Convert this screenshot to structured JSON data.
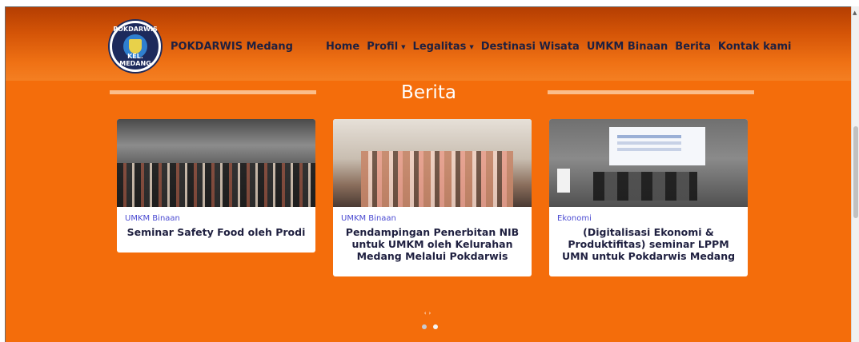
{
  "header": {
    "brand": "POKDARWIS Medang",
    "logo_text_top": "POKDARWIS",
    "logo_text_bottom": "KEL. MEDANG",
    "nav": [
      {
        "label": "Home",
        "dropdown": false
      },
      {
        "label": "Profil",
        "dropdown": true
      },
      {
        "label": "Legalitas",
        "dropdown": true
      },
      {
        "label": "Destinasi Wisata",
        "dropdown": false
      },
      {
        "label": "UMKM Binaan",
        "dropdown": false
      },
      {
        "label": "Berita",
        "dropdown": false
      },
      {
        "label": "Kontak kami",
        "dropdown": false
      }
    ]
  },
  "section": {
    "title": "Berita"
  },
  "cards": [
    {
      "category": "UMKM Binaan",
      "title": "Seminar Safety Food oleh Prodi"
    },
    {
      "category": "UMKM Binaan",
      "title": "Pendampingan Penerbitan NIB untuk UMKM oleh Kelurahan Medang Melalui Pokdarwis"
    },
    {
      "category": "Ekonomi",
      "title": "(Digitalisasi Ekonomi & Produktifitas) seminar LPPM UMN untuk Pokdarwis Medang"
    }
  ],
  "carousel": {
    "prev_glyph": "‹",
    "next_glyph": "›",
    "pages": 2,
    "active_index": 1
  },
  "colors": {
    "primary": "#f46d0b",
    "header_dark": "#b43e02",
    "nav_text": "#1f2040",
    "category_text": "#4b4bd2"
  }
}
